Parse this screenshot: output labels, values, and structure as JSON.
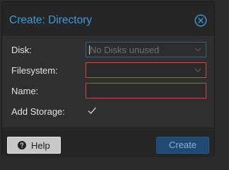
{
  "dialog": {
    "title": "Create: Directory",
    "close_icon": "close-circle-icon"
  },
  "form": {
    "disk": {
      "label": "Disk:",
      "value": "No Disks unused",
      "disabled": true
    },
    "filesystem": {
      "label": "Filesystem:",
      "value": ""
    },
    "name": {
      "label": "Name:",
      "value": ""
    },
    "add_storage": {
      "label": "Add Storage:",
      "checked": true
    }
  },
  "footer": {
    "help_label": "Help",
    "help_icon": "question-circle-icon",
    "create_label": "Create"
  },
  "colors": {
    "accent": "#3a9adf",
    "invalid_border": "#c84a40",
    "create_button_bg": "#1e4a73"
  }
}
